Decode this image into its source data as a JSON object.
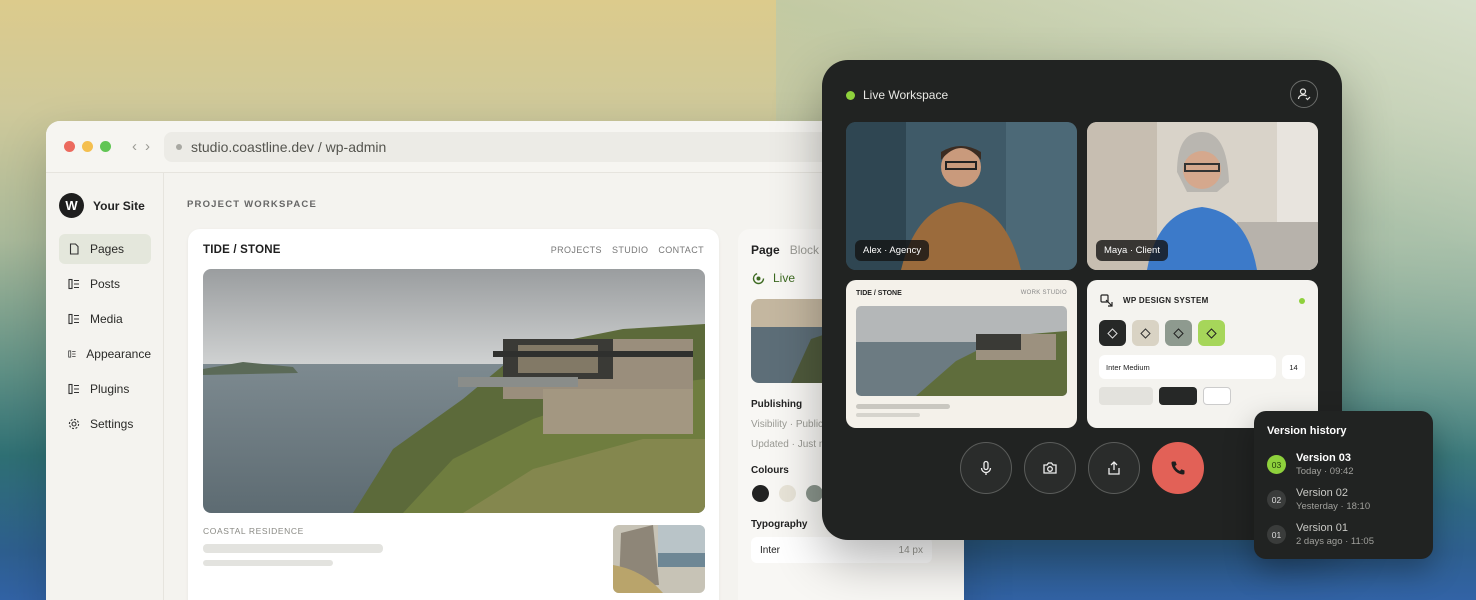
{
  "browser": {
    "url": "studio.coastline.dev / wp-admin",
    "site_name": "Your Site",
    "logo_letter": "W",
    "menu": [
      {
        "label": "Pages"
      },
      {
        "label": "Posts"
      },
      {
        "label": "Media"
      },
      {
        "label": "Appearance"
      },
      {
        "label": "Plugins"
      },
      {
        "label": "Settings"
      }
    ],
    "page_title": "PROJECT WORKSPACE",
    "preview": {
      "brand": "TIDE / STONE",
      "nav": [
        "PROJECTS",
        "STUDIO",
        "CONTACT"
      ],
      "caption": "COASTAL RESIDENCE"
    },
    "panel": {
      "tab_page": "Page",
      "tab_block": "Block",
      "status": "Live",
      "publishing_label": "Publishing",
      "visibility": "Visibility · Public",
      "updated": "Updated · Just now",
      "colours_label": "Colours",
      "swatches": [
        "#222222",
        "#e8e4d8",
        "#8a958c",
        "#2f3a24"
      ],
      "typography_label": "Typography",
      "font": "Inter",
      "font_size": "14 px"
    }
  },
  "workspace": {
    "title": "Live Workspace",
    "participants": [
      {
        "name": "Alex · Agency"
      },
      {
        "name": "Maya · Client"
      }
    ],
    "mini_site": {
      "brand": "TIDE / STONE",
      "nav": "WORK   STUDIO"
    },
    "design_system": {
      "title": "WP DESIGN SYSTEM",
      "font": "Inter Medium",
      "size": "14",
      "tile_colors": [
        "#262827",
        "#d9d3c4",
        "#8e9a8f",
        "#a6d65a"
      ]
    }
  },
  "version_history": {
    "title": "Version history",
    "versions": [
      {
        "num": "03",
        "name": "Version 03",
        "date": "Today · 09:42",
        "current": true
      },
      {
        "num": "02",
        "name": "Version 02",
        "date": "Yesterday · 18:10",
        "current": false
      },
      {
        "num": "01",
        "name": "Version 01",
        "date": "2 days ago · 11:05",
        "current": false
      }
    ]
  }
}
